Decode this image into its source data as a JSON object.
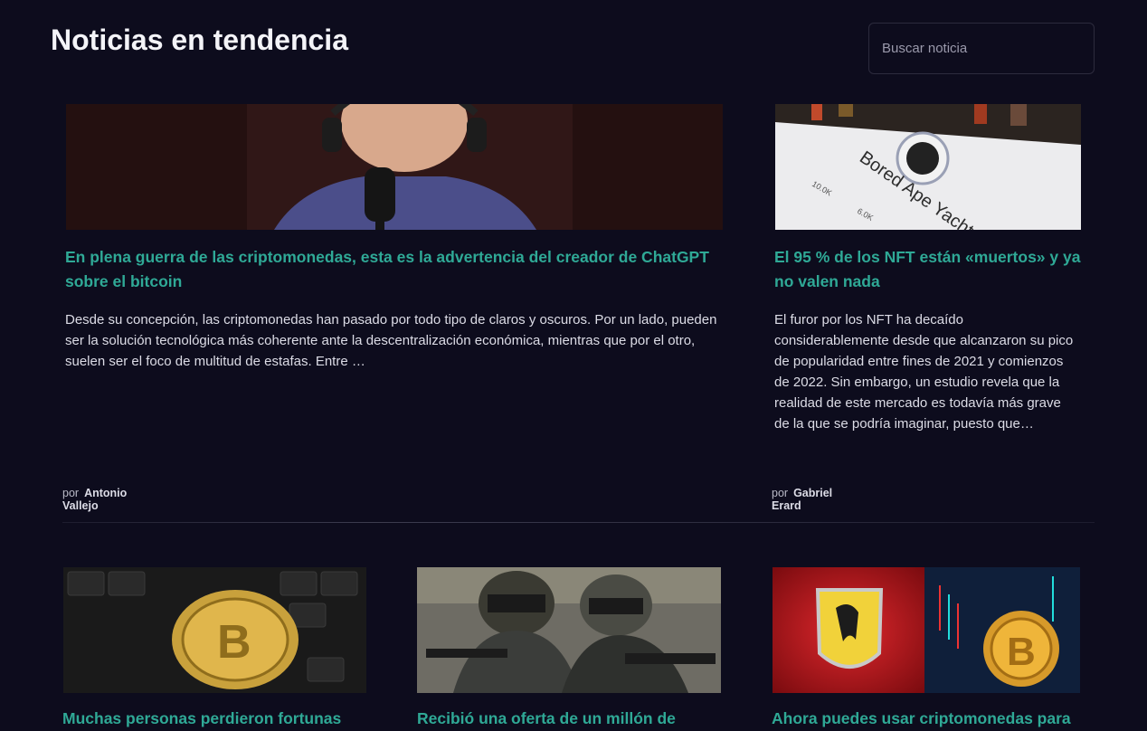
{
  "header": {
    "title": "Noticias en tendencia",
    "search_placeholder": "Buscar noticia"
  },
  "featured": [
    {
      "headline": "En plena guerra de las criptomonedas, esta es la advertencia del creador de ChatGPT sobre el bitcoin",
      "excerpt": "Desde su concepción, las criptomonedas han pasado por todo tipo de claros y oscuros. Por un lado, pueden ser la solución tecnológica más coherente ante la descentralización económica, mientras que por el otro, suelen ser el foco de multitud de estafas. Entre …",
      "by": "por",
      "author": "Antonio Vallejo"
    },
    {
      "headline": "El 95 % de los NFT están «muertos» y ya no valen nada",
      "excerpt": "El furor por los NFT ha decaído considerablemente desde que alcanzaron su pico de popularidad entre fines de 2021 y comienzos de 2022. Sin embargo, un estudio revela que la realidad de este mercado es todavía más grave de la que se podría imaginar, puesto que…",
      "by": "por",
      "author": "Gabriel Erard"
    }
  ],
  "grid": [
    {
      "headline": "Muchas personas perdieron fortunas"
    },
    {
      "headline": "Recibió una oferta de un millón de"
    },
    {
      "headline": "Ahora puedes usar criptomonedas para"
    }
  ]
}
